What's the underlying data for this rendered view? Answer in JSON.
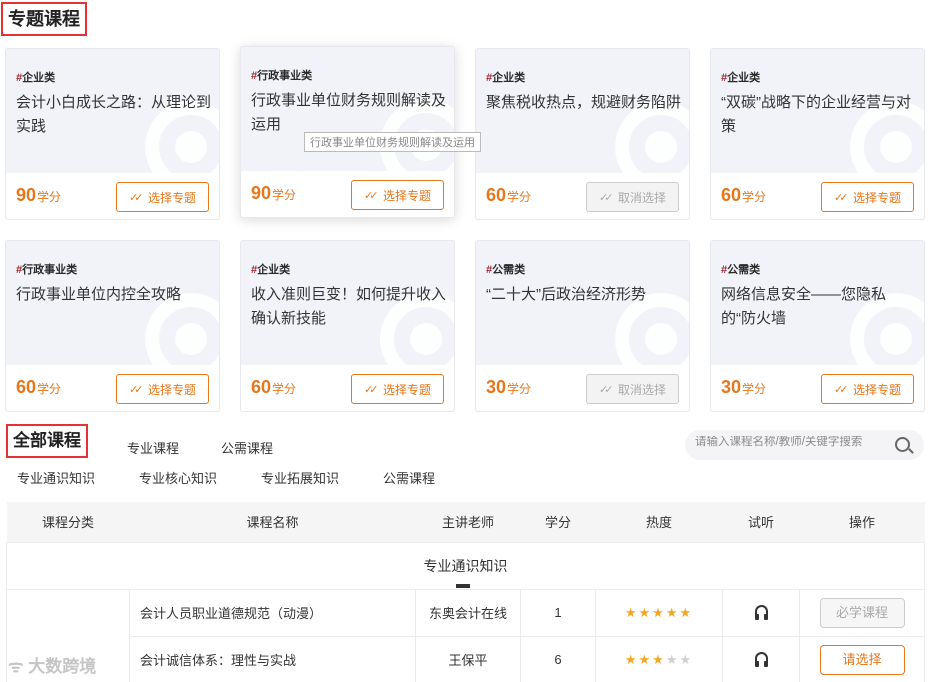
{
  "special_title": "专题课程",
  "cards": [
    {
      "category": "企业类",
      "title": "会计小白成长之路：从理论到实践",
      "score": "90",
      "unit": "学分",
      "button": "选择专题",
      "selected": false
    },
    {
      "category": "行政事业类",
      "title": "行政事业单位财务规则解读及运用",
      "score": "90",
      "unit": "学分",
      "button": "选择专题",
      "selected": false
    },
    {
      "category": "企业类",
      "title": "聚焦税收热点，规避财务陷阱",
      "score": "60",
      "unit": "学分",
      "button": "取消选择",
      "selected": true
    },
    {
      "category": "企业类",
      "title": "“双碳”战略下的企业经营与对策",
      "score": "60",
      "unit": "学分",
      "button": "选择专题",
      "selected": false
    },
    {
      "category": "行政事业类",
      "title": "行政事业单位内控全攻略",
      "score": "60",
      "unit": "学分",
      "button": "选择专题",
      "selected": false
    },
    {
      "category": "企业类",
      "title": "收入准则巨变！如何提升收入确认新技能",
      "score": "60",
      "unit": "学分",
      "button": "选择专题",
      "selected": false
    },
    {
      "category": "公需类",
      "title": "“二十大”后政治经济形势",
      "score": "30",
      "unit": "学分",
      "button": "取消选择",
      "selected": true
    },
    {
      "category": "公需类",
      "title": "网络信息安全——您隐私的“防火墙",
      "score": "30",
      "unit": "学分",
      "button": "选择专题",
      "selected": false
    }
  ],
  "tooltip": "行政事业单位财务规则解读及运用",
  "all_title": "全部课程",
  "tabs": [
    "专业课程",
    "公需课程"
  ],
  "search_placeholder": "请输入课程名称/教师/关键字搜索",
  "subtabs": [
    "专业通识知识",
    "专业核心知识",
    "专业拓展知识",
    "公需课程"
  ],
  "table": {
    "headers": [
      "课程分类",
      "课程名称",
      "主讲老师",
      "学分",
      "热度",
      "试听",
      "操作"
    ],
    "group": "专业通识知识",
    "rows": [
      {
        "name": "会计人员职业道德规范（动漫）",
        "teacher": "东奥会计在线",
        "credit": "1",
        "stars": 5,
        "action": "必学课程",
        "action_enabled": false
      },
      {
        "name": "会计诚信体系：理性与实战",
        "teacher": "王保平",
        "credit": "6",
        "stars": 3,
        "action": "请选择",
        "action_enabled": true
      }
    ]
  },
  "watermark": "大数跨境"
}
